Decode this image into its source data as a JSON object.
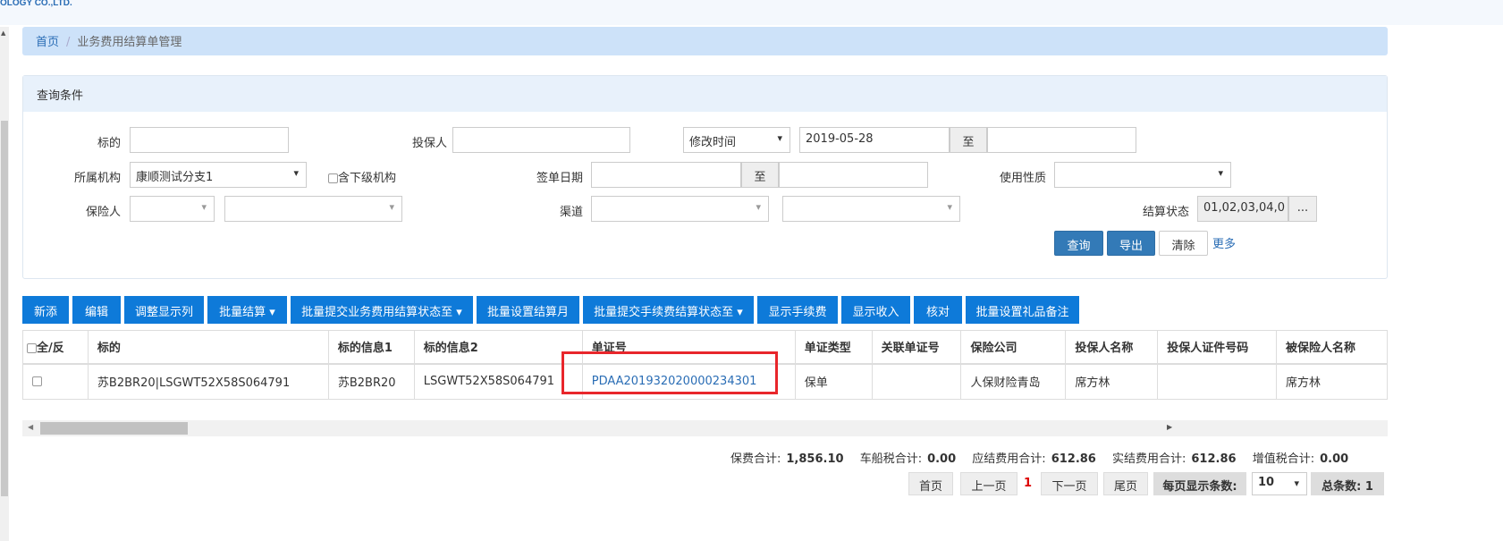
{
  "header": {
    "logo_text": "OLOGY CO.,LTD."
  },
  "breadcrumb": {
    "home": "首页",
    "separator": "/",
    "current": "业务费用结算单管理"
  },
  "query": {
    "title": "查询条件",
    "subject_label": "标的",
    "subject_value": "",
    "applicant_label": "投保人",
    "applicant_value": "",
    "time_type": "修改时间",
    "date_from": "2019-05-28",
    "to_label": "至",
    "date_to": "",
    "org_label": "所属机构",
    "org_value": "康顺测试分支1",
    "include_sub_label": "含下级机构",
    "sign_date_label": "签单日期",
    "sign_to_label": "至",
    "usage_label": "使用性质",
    "usage_value": "",
    "insured_label": "保险人",
    "channel_label": "渠道",
    "settle_status_label": "结算状态",
    "settle_status_value": "01,02,03,04,0",
    "more_dots": "...",
    "search_btn": "查询",
    "export_btn": "导出",
    "clear_btn": "清除",
    "more_link": "更多"
  },
  "toolbar": [
    "新添",
    "编辑",
    "调整显示列",
    "批量结算 ▾",
    "批量提交业务费用结算状态至 ▾",
    "批量设置结算月",
    "批量提交手续费结算状态至 ▾",
    "显示手续费",
    "显示收入",
    "核对",
    "批量设置礼品备注"
  ],
  "table": {
    "headers": [
      "全/反",
      "标的",
      "标的信息1",
      "标的信息2",
      "单证号",
      "单证类型",
      "关联单证号",
      "保险公司",
      "投保人名称",
      "投保人证件号码",
      "被保险人名称"
    ],
    "rows": [
      [
        "",
        "苏B2BR20|LSGWT52X58S064791",
        "苏B2BR20",
        "LSGWT52X58S064791",
        "PDAA201932020000234301",
        "保单",
        "",
        "人保财险青岛",
        "席方林",
        "",
        "席方林"
      ]
    ]
  },
  "totals": {
    "premium_label": "保费合计:",
    "premium": "1,856.10",
    "vessel_tax_label": "车船税合计:",
    "vessel_tax": "0.00",
    "due_fee_label": "应结费用合计:",
    "due_fee": "612.86",
    "actual_fee_label": "实结费用合计:",
    "actual_fee": "612.86",
    "vat_label": "增值税合计:",
    "vat": "0.00"
  },
  "pagination": {
    "first": "首页",
    "prev": "上一页",
    "current": "1",
    "next": "下一页",
    "last": "尾页",
    "page_size_label": "每页显示条数:",
    "page_size": "10",
    "total_label": "总条数: 1"
  }
}
